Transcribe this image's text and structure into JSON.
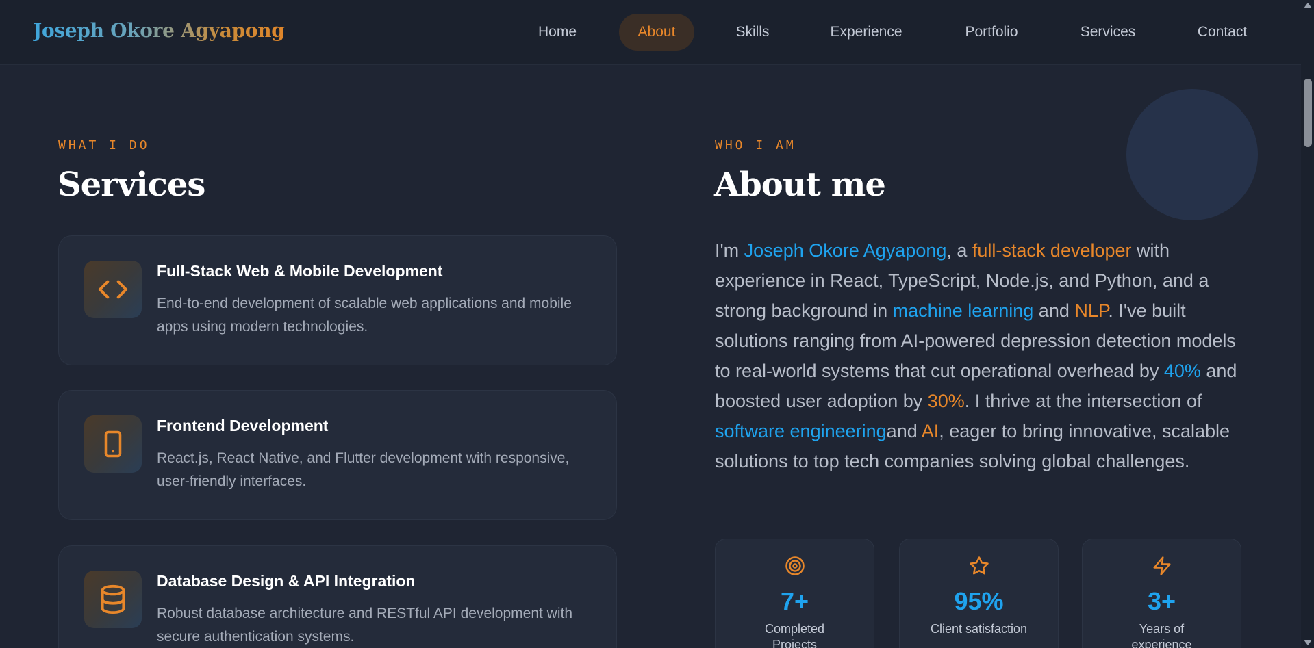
{
  "nav": {
    "logo": "Joseph Okore Agyapong",
    "items": [
      {
        "label": "Home"
      },
      {
        "label": "About"
      },
      {
        "label": "Skills"
      },
      {
        "label": "Experience"
      },
      {
        "label": "Portfolio"
      },
      {
        "label": "Services"
      },
      {
        "label": "Contact"
      }
    ],
    "active": "About"
  },
  "services": {
    "eyebrow": "WHAT I DO",
    "title": "Services",
    "items": [
      {
        "icon": "code-icon",
        "title": "Full-Stack Web & Mobile Development",
        "description": "End-to-end development of scalable web applications and mobile apps using modern technologies."
      },
      {
        "icon": "smartphone-icon",
        "title": "Frontend Development",
        "description": "React.js, React Native, and Flutter development with responsive, user-friendly interfaces."
      },
      {
        "icon": "database-icon",
        "title": "Database Design & API Integration",
        "description": "Robust database architecture and RESTful API development with secure authentication systems."
      }
    ]
  },
  "about": {
    "eyebrow": "WHO I AM",
    "title": "About me",
    "paragraph": {
      "p1": "I'm ",
      "name": "Joseph Okore Agyapong",
      "p2": ", a ",
      "role": "full-stack developer",
      "p3": " with experience in React, TypeScript, Node.js, and Python, and a strong background in ",
      "ml": "machine learning",
      "p4": " and ",
      "nlp": "NLP",
      "p5": ". I've built solutions ranging from AI-powered depression detection models to real-world systems that cut operational overhead by ",
      "pct1": "40%",
      "p6": " and boosted user adoption by ",
      "pct2": "30%",
      "p7": ". I thrive at the intersection of ",
      "se": "software engineering",
      "p8": "and ",
      "ai": "AI",
      "p9": ", eager to bring innovative, scalable solutions to top tech companies solving global challenges."
    },
    "stats": [
      {
        "icon": "target-icon",
        "value": "7+",
        "label": "Completed Projects"
      },
      {
        "icon": "star-icon",
        "value": "95%",
        "label": "Client satisfaction"
      },
      {
        "icon": "lightning-icon",
        "value": "3+",
        "label": "Years of experience"
      }
    ]
  },
  "colors": {
    "accent_orange": "#e8872a",
    "accent_blue": "#1fa3ee",
    "background": "#1f2533"
  }
}
